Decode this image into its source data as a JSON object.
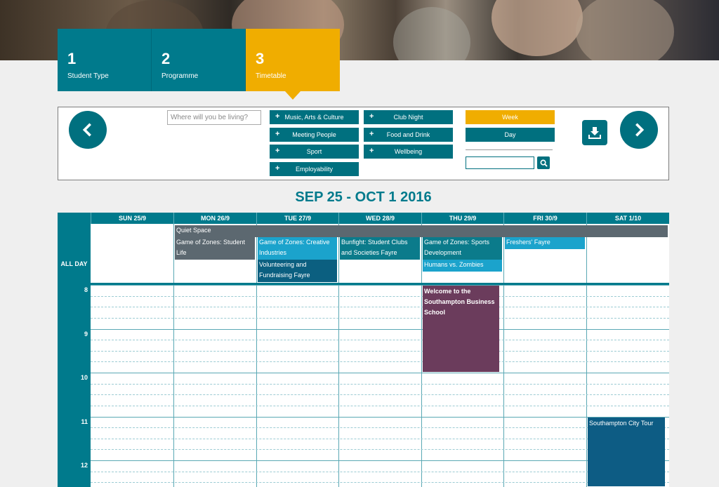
{
  "steps": [
    {
      "num": "1",
      "label": "Student Type"
    },
    {
      "num": "2",
      "label": "Programme"
    },
    {
      "num": "3",
      "label": "Timetable"
    }
  ],
  "filters": {
    "location_placeholder": "Where will you be living?",
    "categories": [
      "Music, Arts & Culture",
      "Meeting People",
      "Sport",
      "Employability",
      "Club Night",
      "Food and Drink",
      "Wellbeing"
    ],
    "plus": "+",
    "views": {
      "week": "Week",
      "day": "Day"
    }
  },
  "title": "SEP 25 - OCT 1 2016",
  "calendar": {
    "days": [
      "SUN 25/9",
      "MON 26/9",
      "TUE 27/9",
      "WED 28/9",
      "THU 29/9",
      "FRI 30/9",
      "SAT 1/10"
    ],
    "all_day_label": "ALL DAY",
    "hours": [
      "8",
      "9",
      "10",
      "11",
      "12"
    ],
    "all_day_events": [
      {
        "title": "Quiet Space",
        "day_start": 1,
        "day_end": 6,
        "row": 0,
        "color": "gray"
      },
      {
        "title": "Game of Zones: Student Life",
        "day_start": 1,
        "day_end": 1,
        "row": 1,
        "color": "gray"
      },
      {
        "title": "Game of Zones: Creative Industries",
        "day_start": 2,
        "day_end": 2,
        "row": 1,
        "color": "lblue"
      },
      {
        "title": "Volunteering and Fundraising Fayre",
        "day_start": 2,
        "day_end": 2,
        "row": 3,
        "color": "dblue"
      },
      {
        "title": "Bunfight: Student Clubs and Societies Fayre",
        "day_start": 3,
        "day_end": 3,
        "row": 1,
        "color": "teal"
      },
      {
        "title": "Game of Zones: Sports Development",
        "day_start": 4,
        "day_end": 4,
        "row": 1,
        "color": "teal"
      },
      {
        "title": "Humans vs. Zombies",
        "day_start": 4,
        "day_end": 4,
        "row": 3,
        "color": "lblue"
      },
      {
        "title": "Freshers' Fayre",
        "day_start": 5,
        "day_end": 5,
        "row": 1,
        "color": "lblue"
      }
    ],
    "timed_events": [
      {
        "title": "Welcome to the Southampton Business School",
        "day": 4,
        "start": 8,
        "end": 10,
        "color": "plum"
      },
      {
        "title": "Southampton City Tour",
        "day": 6,
        "start": 11,
        "end": 13,
        "color": "navy"
      }
    ]
  }
}
